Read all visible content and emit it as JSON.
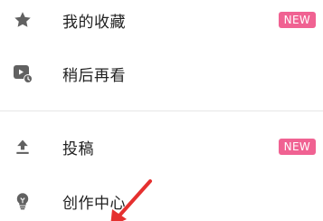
{
  "menu": {
    "items": [
      {
        "label": "我的收藏",
        "icon": "star-icon",
        "badge": "NEW"
      },
      {
        "label": "稍后再看",
        "icon": "watch-later-icon"
      },
      {
        "label": "投稿",
        "icon": "upload-icon",
        "badge": "NEW"
      },
      {
        "label": "创作中心",
        "icon": "lightbulb-icon"
      }
    ]
  },
  "colors": {
    "badge": "#f06292",
    "icon": "#616161",
    "text": "#212121",
    "annotation_arrow": "#e5302f"
  }
}
